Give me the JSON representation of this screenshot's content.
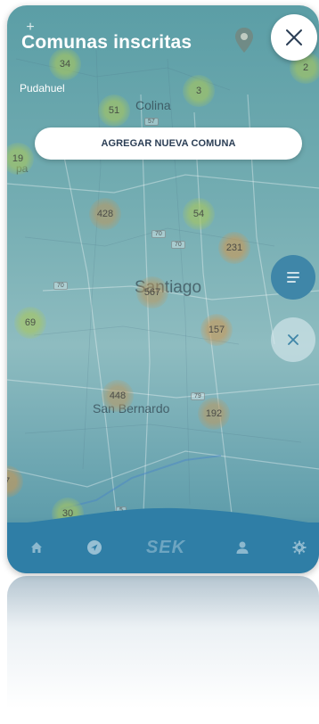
{
  "header": {
    "title": "Comunas inscritas",
    "subtitle": "Pudahuel"
  },
  "add_button": {
    "label": "AGREGAR NUEVA COMUNA"
  },
  "zoom": {
    "plus": "+",
    "minus": "−"
  },
  "map": {
    "place_labels": {
      "colina": "Colina",
      "santiago": "Santiago",
      "san_bernardo": "San Bernardo",
      "pa": "pa"
    },
    "clusters": {
      "c34": "34",
      "c3": "3",
      "c51": "51",
      "c2": "2",
      "c19": "19",
      "c428": "428",
      "c54": "54",
      "c231": "231",
      "c567": "567",
      "c69": "69",
      "c157": "157",
      "c448": "448",
      "c192": "192",
      "c7": "7",
      "c30": "30"
    },
    "road_shields": {
      "r57": "57",
      "r70a": "70",
      "r70b": "70",
      "r70c": "70",
      "r79": "79",
      "r5": "5"
    }
  },
  "bottom_nav": {
    "items": [
      "home-icon",
      "navigation-icon",
      "logo",
      "user-icon",
      "settings-icon"
    ],
    "logo_text": "SEK"
  },
  "colors": {
    "accent": "#3f86a8",
    "nav_bg": "#2f7ea6",
    "button_text": "#2b3e55"
  }
}
